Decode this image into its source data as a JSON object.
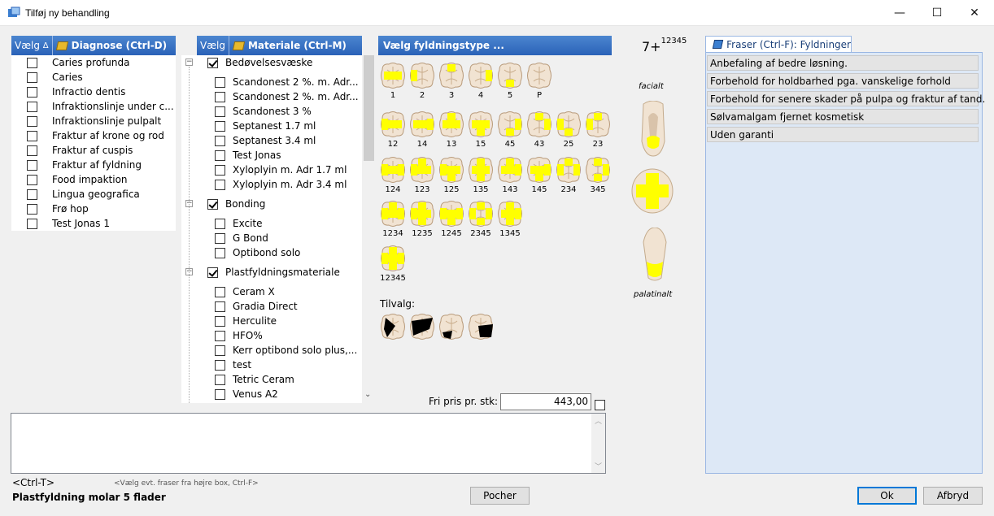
{
  "window": {
    "title": "Tilføj ny behandling",
    "minimize": "—",
    "maximize": "☐",
    "close": "✕"
  },
  "diagnose": {
    "vaelg": "Vælg",
    "sort_arrow": "Δ",
    "header": "Diagnose (Ctrl-D)",
    "items": [
      "Caries profunda",
      "Caries",
      "Infractio dentis",
      "Infraktionslinje under c...",
      "Infraktionslinje pulpalt",
      "Fraktur af krone og rod",
      "Fraktur af cuspis",
      "Fraktur af fyldning",
      "Food impaktion",
      "Lingua geografica",
      "Frø hop",
      "Test Jonas 1"
    ]
  },
  "materiale": {
    "vaelg": "Vælg",
    "header": "Materiale (Ctrl-M)",
    "groups": [
      {
        "label": "Bedøvelsesvæske",
        "checked": true,
        "items": [
          "Scandonest 2 %. m. Adr...",
          "Scandonest 2 %. m. Adr...",
          "Scandonest 3 %",
          "Septanest 1.7 ml",
          "Septanest 3.4 ml",
          "Test Jonas",
          "Xyloplyin m. Adr 1.7 ml",
          "Xyloplyin m. Adr 3.4 ml"
        ]
      },
      {
        "label": "Bonding",
        "checked": true,
        "items": [
          "Excite",
          "G Bond",
          "Optibond solo"
        ]
      },
      {
        "label": "Plastfyldningsmateriale",
        "checked": true,
        "items": [
          "Ceram X",
          "Gradia Direct",
          "Herculite",
          "HFO%",
          "Kerr optibond solo plus,...",
          "test",
          "Tetric Ceram",
          "Venus A2"
        ]
      }
    ]
  },
  "fyldning": {
    "header": "Vælg fyldningstype ...",
    "rows": [
      [
        "1",
        "2",
        "3",
        "4",
        "5",
        "P"
      ],
      [
        "12",
        "14",
        "13",
        "15",
        "45",
        "43",
        "25",
        "23"
      ],
      [
        "124",
        "123",
        "125",
        "135",
        "143",
        "145",
        "234",
        "345"
      ],
      [
        "1234",
        "1235",
        "1245",
        "2345",
        "1345"
      ],
      [
        "12345"
      ]
    ],
    "tilvalg_label": "Tilvalg:",
    "fri_pris_label": "Fri pris pr. stk:",
    "fri_pris_value": "443,00",
    "fill_color": "#ffff00"
  },
  "tooth_view": {
    "number": "7+",
    "surfaces": "12345",
    "facialt": "facialt",
    "palatinalt": "palatinalt"
  },
  "fraser": {
    "tab": "Fraser (Ctrl-F): Fyldninger",
    "items": [
      "Anbefaling af bedre løsning.",
      "Forbehold for holdbarhed pga. vanskelige forhold",
      "Forbehold for senere skader på pulpa og fraktur af tand.",
      "Sølvamalgam fjernet kosmetisk",
      "Uden garanti"
    ]
  },
  "footer": {
    "ctrl_t": "<Ctrl-T>",
    "hint": "<Vælg evt. fraser fra højre box, Ctrl-F>",
    "summary": "Plastfyldning molar 5 flader",
    "pocher": "Pocher",
    "ok": "Ok",
    "afbryd": "Afbryd"
  }
}
